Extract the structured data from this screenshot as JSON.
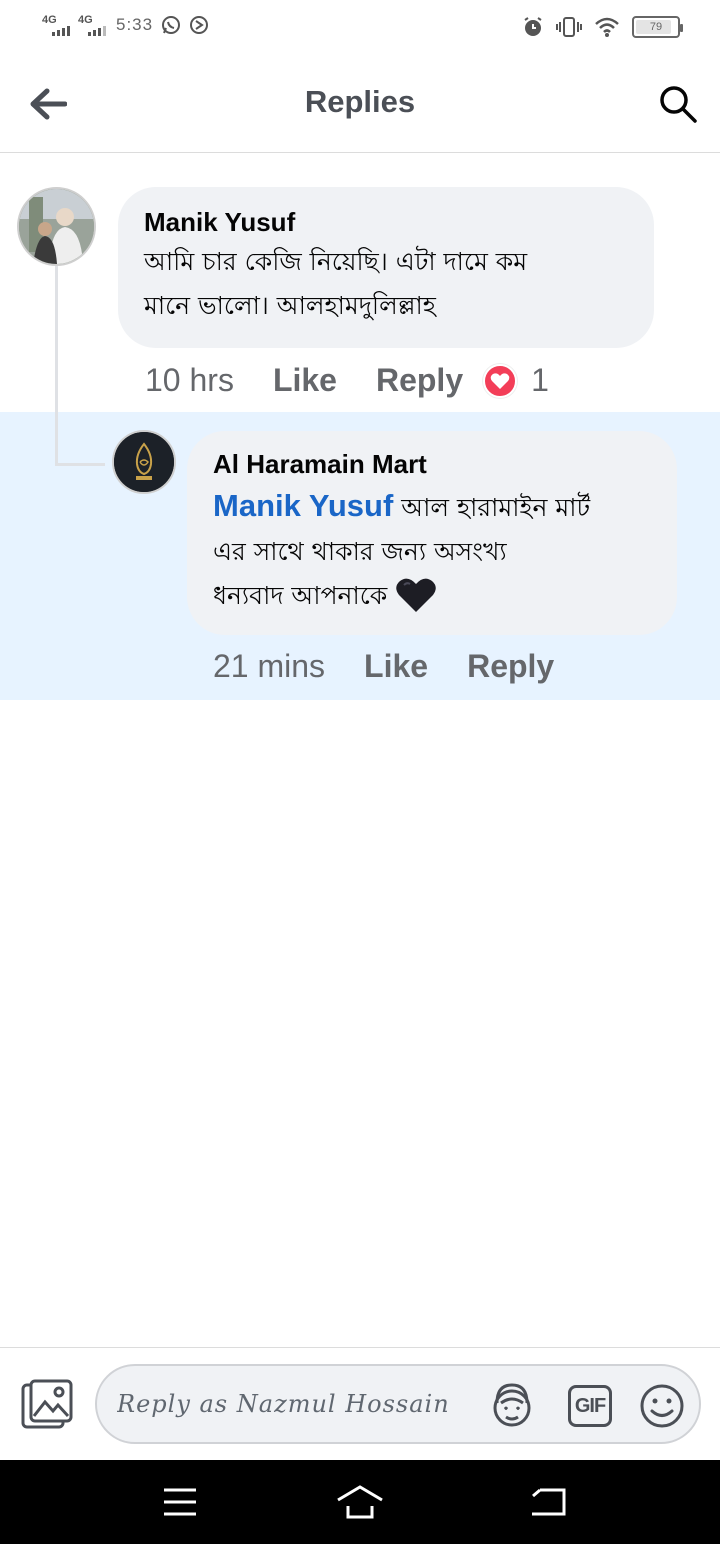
{
  "status_bar": {
    "network_1": "4G",
    "network_2": "4G",
    "time": "5:33",
    "battery": "79",
    "battery_level": 0.79
  },
  "header": {
    "title": "Replies",
    "back_icon": "arrow-left-icon",
    "search_icon": "search-icon"
  },
  "comments": [
    {
      "author": "Manik Yusuf",
      "text_line1": "আমি চার কেজি নিয়েছি। এটা দামে কম",
      "text_line2": "মানে ভালো। আলহামদুলিল্লাহ",
      "time": "10 hrs",
      "like_label": "Like",
      "reply_label": "Reply",
      "reaction_icon": "love-reaction-icon",
      "reaction_count": "1"
    },
    {
      "author": "Al Haramain Mart",
      "mention": "Manik Yusuf",
      "text_line1": "আল হারামাইন মার্ট",
      "text_line2": "এর সাথে থাকার জন্য অসংখ্য",
      "text_line3": "ধন্যবাদ আপনাকে",
      "emoji": "black-heart-emoji",
      "time": "21 mins",
      "like_label": "Like",
      "reply_label": "Reply"
    }
  ],
  "composer": {
    "placeholder": "Reply as Nazmul Hossain",
    "value": "",
    "photo_icon": "photo-icon",
    "avatar_sticker_icon": "avatar-sticker-icon",
    "gif_label": "GIF",
    "emoji_icon": "smiley-icon"
  },
  "nav_bar": {
    "menu_icon": "menu-icon",
    "home_icon": "home-icon",
    "back_icon": "back-icon"
  },
  "colors": {
    "mention": "#1a66c7",
    "bubble": "#f0f2f5",
    "highlight": "#e7f3ff",
    "love": "#f33e58",
    "meta_text": "#65676b"
  }
}
